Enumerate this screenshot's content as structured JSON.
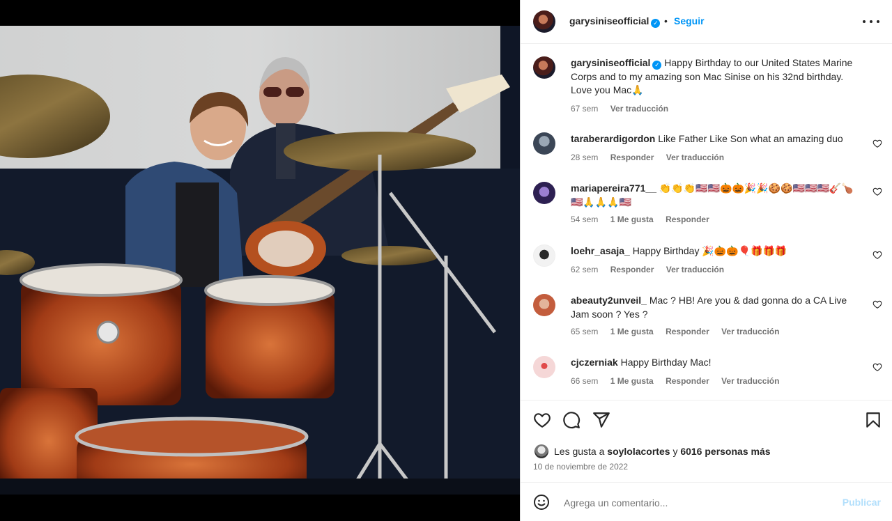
{
  "post": {
    "username": "garysiniseofficial",
    "follow_label": "Seguir",
    "separator": "•"
  },
  "caption": {
    "username": "garysiniseofficial",
    "text": "Happy Birthday to our United States Marine Corps and to my amazing son Mac Sinise on his 32nd birthday. Love you Mac🙏",
    "time": "67 sem",
    "translate": "Ver traducción"
  },
  "comments": [
    {
      "username": "taraberardigordon",
      "text": "Like Father Like Son what an amazing duo",
      "time": "28 sem",
      "likes": "",
      "reply": "Responder",
      "translate": "Ver traducción"
    },
    {
      "username": "mariapereira771__",
      "text": "👏👏👏🇺🇸🇺🇸🎃🎃🎉🎉🍪🍪🇺🇸🇺🇸🇺🇸🎸🍗🇺🇸🙏🙏🙏🇺🇸",
      "time": "54 sem",
      "likes": "1 Me gusta",
      "reply": "Responder",
      "translate": ""
    },
    {
      "username": "loehr_asaja_",
      "text": "Happy Birthday 🎉🎃🎃🎈🎁🎁🎁",
      "time": "62 sem",
      "likes": "",
      "reply": "Responder",
      "translate": "Ver traducción"
    },
    {
      "username": "abeauty2unveil_",
      "text": "Mac ? HB! Are you & dad gonna do a CA Live Jam soon ? Yes ?",
      "time": "65 sem",
      "likes": "1 Me gusta",
      "reply": "Responder",
      "translate": "Ver traducción"
    },
    {
      "username": "cjczerniak",
      "text": "Happy Birthday Mac!",
      "time": "66 sem",
      "likes": "1 Me gusta",
      "reply": "Responder",
      "translate": "Ver traducción"
    }
  ],
  "likes": {
    "prefix": "Les gusta a",
    "user": "soylolacortes",
    "middle": "y",
    "others": "6016 personas más"
  },
  "date": "10 de noviembre de 2022",
  "comment_box": {
    "placeholder": "Agrega un comentario...",
    "publish_label": "Publicar"
  },
  "colors": {
    "accent": "#0095f6",
    "publish_disabled": "#b2dffc",
    "muted": "#737373"
  },
  "icons": [
    "heart-icon",
    "comment-icon",
    "share-icon",
    "bookmark-icon",
    "emoji-icon",
    "more-icon",
    "verified-icon"
  ]
}
